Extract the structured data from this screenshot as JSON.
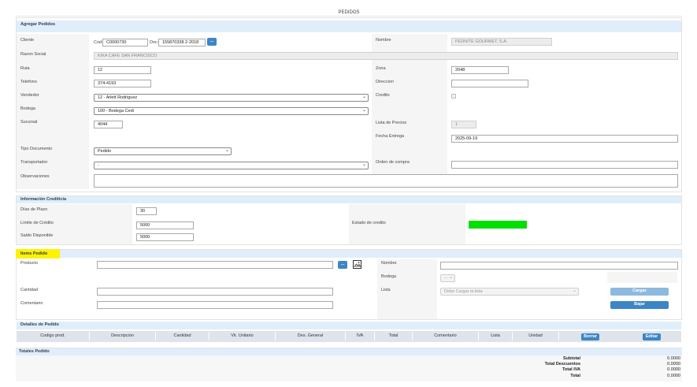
{
  "page_title": "PEDIDOS",
  "agregar": {
    "header": "Agregar Pedidos",
    "cliente_label": "Cliente",
    "cod_label": "Cod:",
    "cod_value": "C0000730",
    "doc_label": "Doc:",
    "doc_value": "155870338 2-2018",
    "lookup_label": "...",
    "nombre_label": "Nombre",
    "nombre_value": "PEDNITE GOURMET, S.A.",
    "razon_label": "Razon Social",
    "razon_value": "KIKA CAFE SAN FRANCISCO",
    "ruta_label": "Ruta",
    "ruta_value": "12",
    "zona_label": "Zona",
    "zona_value": "2048",
    "telefono_label": "Telefono",
    "telefono_value": "374-4193",
    "direccion_label": "Direccion",
    "direccion_value": "",
    "vendedor_label": "Vendedor",
    "vendedor_value": "12 - Arlett Rodriguez",
    "credito_label": "Credito",
    "bodega_label": "Bodega",
    "bodega_value": "100 - Bodega Cedi",
    "sucursal_label": "Sucursal",
    "sucursal_value": "4044",
    "lista_precio_label": "Lista de Precios",
    "lista_precio_value": "1",
    "fecha_entrega_label": "Fecha Entrega",
    "fecha_entrega_value": "2025-09-19",
    "tipo_doc_label": "Tipo Documento",
    "tipo_doc_value": "Pedido",
    "transportador_label": "Transportador",
    "transportador_value": "-",
    "orden_compra_label": "Orden de compra",
    "orden_compra_value": "",
    "observaciones_label": "Observaciones",
    "observaciones_value": ""
  },
  "credito": {
    "header": "Información Crediticia",
    "dias_plazo_label": "Días de Plazo",
    "dias_plazo_value": "30",
    "limite_label": "Límite de Crédito",
    "limite_value": "5000",
    "saldo_label": "Saldo Disponible",
    "saldo_value": "5000",
    "estado_label": "Estado de credito",
    "estado_color": "#00e000"
  },
  "items": {
    "header": "Items Pedido",
    "producto_label": "Producto",
    "producto_value": "",
    "lookup_label": "...",
    "nombre_label": "Nombre",
    "nombre_value": "",
    "bodega_label": "Bodega",
    "bodega_value": "--",
    "lista_label": "Lista",
    "lista_value": "Debe Cargar la lista",
    "cantidad_label": "Cantidad",
    "cantidad_value": "",
    "comentario_label": "Comentario",
    "comentario_value": "",
    "cargar_label": "Cargar",
    "bajar_label": "Bajar"
  },
  "detalles": {
    "header": "Detalles de Pedido",
    "columns": [
      "Codigo prod.",
      "Descripcion",
      "Cantidad",
      "Vlr. Unitario",
      "Des. General",
      "IVA",
      "Total",
      "Comentario",
      "Lista",
      "Unidad"
    ],
    "borrar_label": "Borrar",
    "editar_label": "Editar"
  },
  "totales": {
    "header": "Totales Pedido",
    "rows": [
      {
        "label": "Subtotal",
        "value": "0.0000"
      },
      {
        "label": "Total Descuentos",
        "value": "0.0000"
      },
      {
        "label": "Total IVA",
        "value": "0.0000"
      },
      {
        "label": "Total",
        "value": "0.0000"
      }
    ]
  },
  "colors": {
    "accent": "#3c86c6",
    "band": "#dfeefa",
    "highlight": "#fff200"
  }
}
